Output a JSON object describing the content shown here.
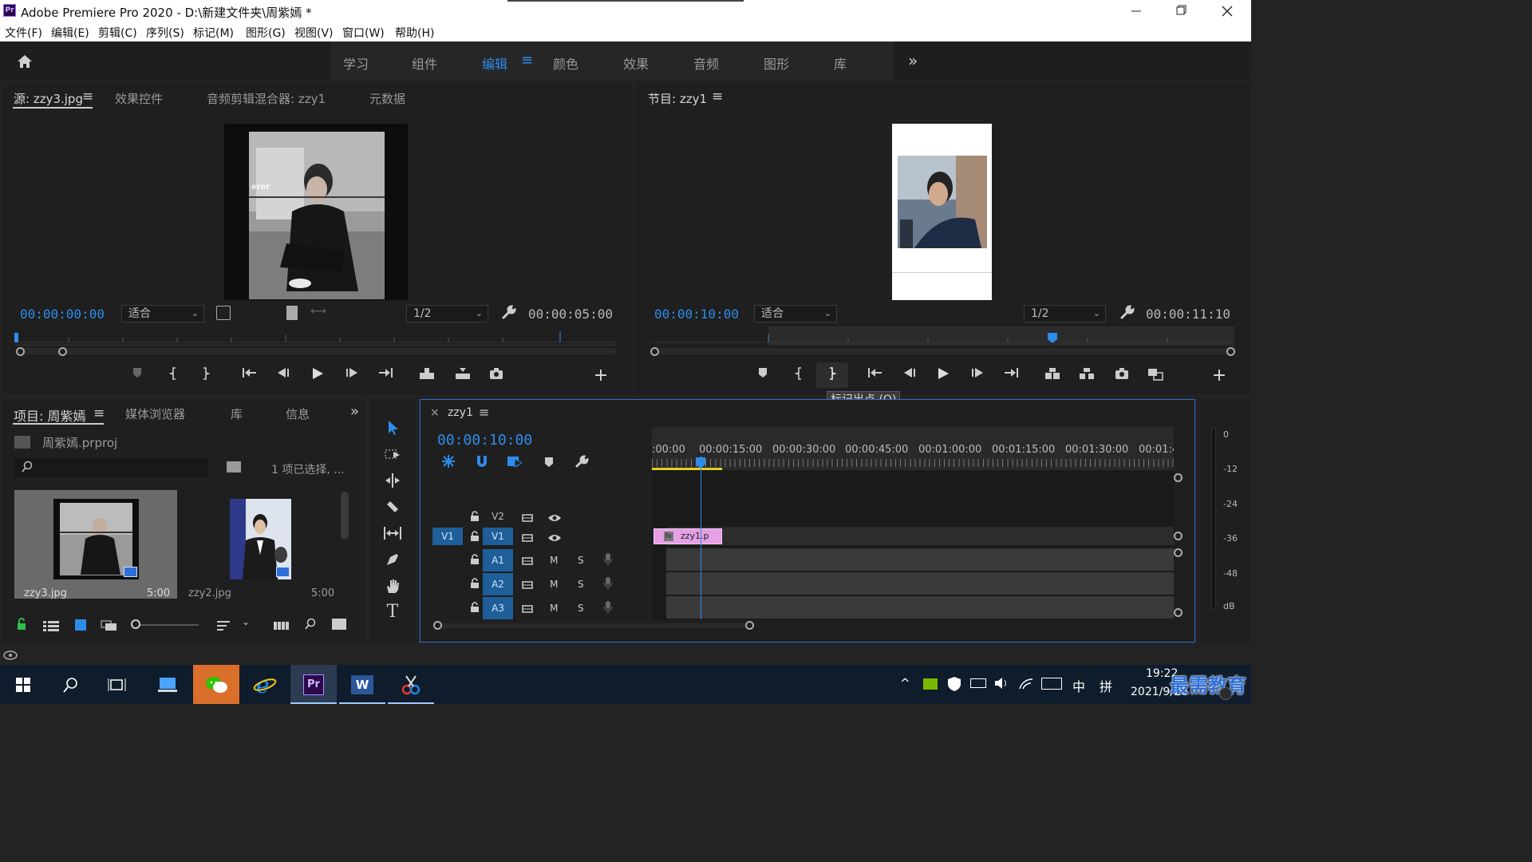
{
  "window": {
    "app_icon": "Pr",
    "title": "Adobe Premiere Pro 2020 - D:\\新建文件夹\\周紫嫣 *",
    "controls": [
      "minimize-icon",
      "maximize-icon",
      "close-icon"
    ]
  },
  "menu": [
    "文件(F)",
    "编辑(E)",
    "剪辑(C)",
    "序列(S)",
    "标记(M)",
    "图形(G)",
    "视图(V)",
    "窗口(W)",
    "帮助(H)"
  ],
  "workspace": {
    "tabs": [
      "学习",
      "组件",
      "编辑",
      "颜色",
      "效果",
      "音频",
      "图形",
      "库"
    ],
    "active": "编辑",
    "more": "»"
  },
  "source_monitor": {
    "tabs": [
      "源: zzy3.jpg",
      "效果控件",
      "音频剪辑混合器: zzy1",
      "元数据"
    ],
    "image_caption": "erer",
    "timecode_in": "00:00:00:00",
    "fit_value": "适合",
    "resolution_value": "1/2",
    "timecode_duration": "00:00:05:00"
  },
  "program_monitor": {
    "tab": "节目: zzy1",
    "timecode_in": "00:00:10:00",
    "fit_value": "适合",
    "resolution_value": "1/2",
    "timecode_duration": "00:00:11:10",
    "tooltip": "标记出点 (O)"
  },
  "project": {
    "tabs": [
      "项目: 周紫嫣",
      "媒体浏览器",
      "库",
      "信息"
    ],
    "more": "»",
    "file_name": "周紫嫣.prproj",
    "search_placeholder": "",
    "selection_status": "1 项已选择, ...",
    "items": [
      {
        "name": "zzy3.jpg",
        "duration": "5:00"
      },
      {
        "name": "zzy2.jpg",
        "duration": "5:00"
      }
    ]
  },
  "timeline": {
    "close": "×",
    "sequence_name": "zzy1",
    "timecode": "00:00:10:00",
    "ruler_labels": [
      ":00:00",
      "00:00:15:00",
      "00:00:30:00",
      "00:00:45:00",
      "00:01:00:00",
      "00:01:15:00",
      "00:01:30:00",
      "00:01:4"
    ],
    "video_tracks": [
      "V2",
      "V1"
    ],
    "source_patch": "V1",
    "audio_tracks": [
      "A1",
      "A2",
      "A3"
    ],
    "mute_label": "M",
    "solo_label": "S",
    "clip_label": "zzy1.p",
    "clip_fx": "fx"
  },
  "audio_meter": {
    "labels": [
      "0",
      "-12",
      "-24",
      "-36",
      "-48",
      "dB"
    ]
  },
  "taskbar": {
    "clock_time": "19:22",
    "clock_date": "2021/9/26",
    "ime_lang": "中",
    "ime_mode": "拼",
    "watermark": "最需教育"
  },
  "colors": {
    "accent": "#2d8ceb",
    "panel_bg": "#1f1f1f",
    "app_bg": "#232323",
    "clip_pink": "#e6a0e6",
    "track_blue": "#1f5f99",
    "taskbar": "#0f1c2c"
  }
}
